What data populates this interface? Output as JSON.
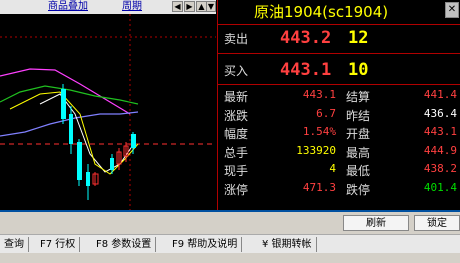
{
  "toolbar": {
    "overlay_label": "商品叠加",
    "period_label": "周期"
  },
  "quote": {
    "title": "原油1904(sc1904)",
    "sell_label": "卖出",
    "sell_price": "443.2",
    "sell_vol": "12",
    "buy_label": "买入",
    "buy_price": "443.1",
    "buy_vol": "10",
    "rows": [
      {
        "l1": "最新",
        "v1": "443.1",
        "c1": "#ff4040",
        "l2": "结算",
        "v2": "441.4",
        "c2": "#ff4040"
      },
      {
        "l1": "涨跌",
        "v1": "6.7",
        "c1": "#ff4040",
        "l2": "昨结",
        "v2": "436.4",
        "c2": "#ffffff"
      },
      {
        "l1": "幅度",
        "v1": "1.54%",
        "c1": "#ff4040",
        "l2": "开盘",
        "v2": "443.1",
        "c2": "#ff4040"
      },
      {
        "l1": "总手",
        "v1": "133920",
        "c1": "#ffff00",
        "l2": "最高",
        "v2": "444.9",
        "c2": "#ff4040"
      },
      {
        "l1": "现手",
        "v1": "4",
        "c1": "#ffff00",
        "l2": "最低",
        "v2": "438.2",
        "c2": "#ff4040"
      },
      {
        "l1": "涨停",
        "v1": "471.3",
        "c1": "#ff4040",
        "l2": "跌停",
        "v2": "401.4",
        "c2": "#00dd00"
      }
    ]
  },
  "buttons": {
    "refresh": "刷新",
    "lock": "锁定"
  },
  "fkeys": [
    "查询",
    "F7 行权",
    "F8 参数设置",
    "F9 帮助及说明",
    "¥ 银期转帐"
  ]
}
